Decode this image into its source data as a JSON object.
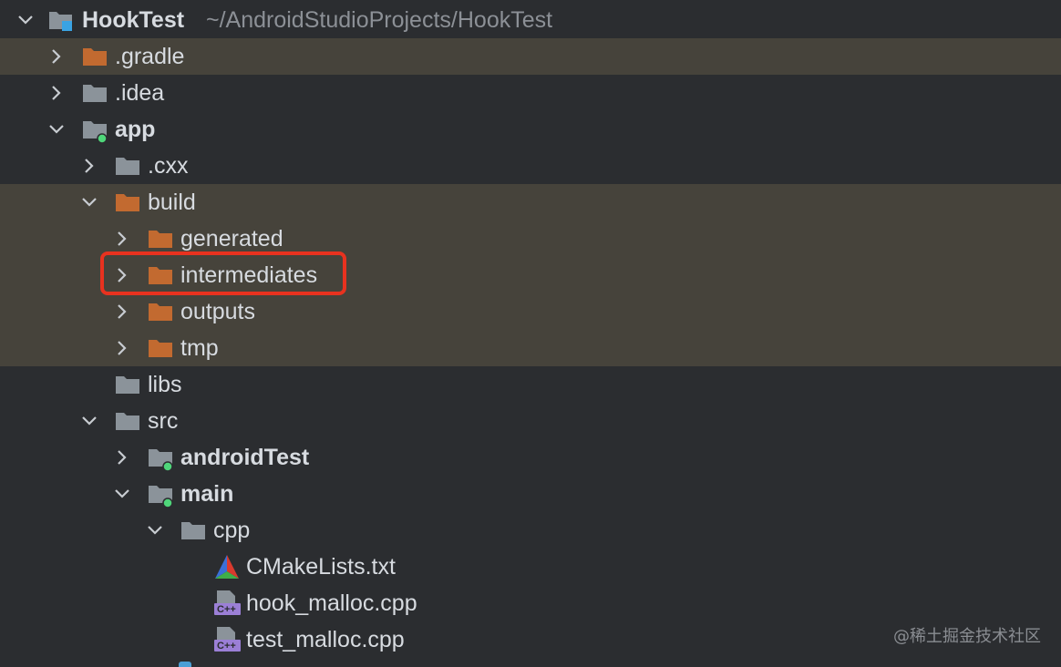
{
  "colors": {
    "background": "#2b2d30",
    "excluded_row": "#46433b",
    "folder_gray": "#8b939a",
    "folder_orange": "#c26a30",
    "module_dot": "#4fd67a",
    "project_badge": "#3aa3e3",
    "highlight": "#e8321f",
    "text": "#d7dbe0",
    "path_text": "#8c9096"
  },
  "root": {
    "name": "HookTest",
    "path": "~/AndroidStudioProjects/HookTest",
    "icon": "project-folder-icon",
    "expanded": true
  },
  "items": [
    {
      "label": ".gradle",
      "icon": "folder-excluded-icon",
      "expanded": false,
      "has_children": true,
      "excluded": true,
      "bold": false
    },
    {
      "label": ".idea",
      "icon": "folder-icon",
      "expanded": false,
      "has_children": true,
      "excluded": false,
      "bold": false
    },
    {
      "label": "app",
      "icon": "module-folder-icon",
      "expanded": true,
      "has_children": true,
      "excluded": false,
      "bold": true
    },
    {
      "label": ".cxx",
      "icon": "folder-icon",
      "expanded": false,
      "has_children": true,
      "excluded": false,
      "bold": false
    },
    {
      "label": "build",
      "icon": "folder-excluded-icon",
      "expanded": true,
      "has_children": true,
      "excluded": true,
      "bold": false
    },
    {
      "label": "generated",
      "icon": "folder-excluded-icon",
      "expanded": false,
      "has_children": true,
      "excluded": true,
      "bold": false
    },
    {
      "label": "intermediates",
      "icon": "folder-excluded-icon",
      "expanded": false,
      "has_children": true,
      "excluded": true,
      "bold": false,
      "highlighted": true
    },
    {
      "label": "outputs",
      "icon": "folder-excluded-icon",
      "expanded": false,
      "has_children": true,
      "excluded": true,
      "bold": false
    },
    {
      "label": "tmp",
      "icon": "folder-excluded-icon",
      "expanded": false,
      "has_children": true,
      "excluded": true,
      "bold": false
    },
    {
      "label": "libs",
      "icon": "folder-icon",
      "expanded": false,
      "has_children": false,
      "excluded": false,
      "bold": false
    },
    {
      "label": "src",
      "icon": "folder-icon",
      "expanded": true,
      "has_children": true,
      "excluded": false,
      "bold": false
    },
    {
      "label": "androidTest",
      "icon": "module-folder-icon",
      "expanded": false,
      "has_children": true,
      "excluded": false,
      "bold": true
    },
    {
      "label": "main",
      "icon": "module-folder-icon",
      "expanded": true,
      "has_children": true,
      "excluded": false,
      "bold": true
    },
    {
      "label": "cpp",
      "icon": "folder-icon",
      "expanded": true,
      "has_children": true,
      "excluded": false,
      "bold": false
    },
    {
      "label": "CMakeLists.txt",
      "icon": "cmake-icon",
      "expanded": false,
      "has_children": false,
      "excluded": false,
      "bold": false
    },
    {
      "label": "hook_malloc.cpp",
      "icon": "cpp-file-icon",
      "expanded": false,
      "has_children": false,
      "excluded": false,
      "bold": false
    },
    {
      "label": "test_malloc.cpp",
      "icon": "cpp-file-icon",
      "expanded": false,
      "has_children": false,
      "excluded": false,
      "bold": false
    }
  ],
  "cpp_badge": "C++",
  "watermark": "@稀土掘金技术社区"
}
